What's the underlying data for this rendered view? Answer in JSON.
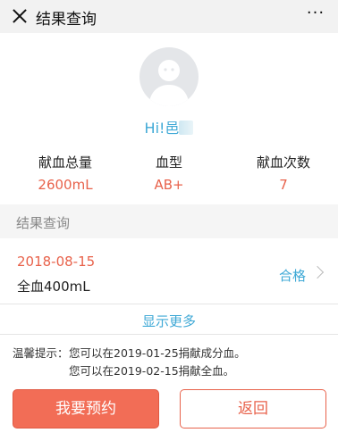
{
  "header": {
    "title": "结果查询",
    "more_label": "···"
  },
  "user": {
    "greeting": "Hi!邑"
  },
  "stats": [
    {
      "label": "献血总量",
      "value": "2600mL"
    },
    {
      "label": "血型",
      "value": "AB+"
    },
    {
      "label": "献血次数",
      "value": "7"
    }
  ],
  "section": {
    "title": "结果查询"
  },
  "records": [
    {
      "date": "2018-08-15",
      "type": "全血400mL",
      "status": "合格"
    }
  ],
  "show_more": "显示更多",
  "tips": {
    "label": "温馨提示：",
    "line1": "您可以在2019-01-25捐献成分血。",
    "line2": "您可以在2019-02-15捐献全血。"
  },
  "buttons": {
    "primary": "我要预约",
    "secondary": "返回"
  },
  "colors": {
    "accent": "#e8624b",
    "link": "#3fa9d6",
    "primary_button": "#f26d56"
  }
}
